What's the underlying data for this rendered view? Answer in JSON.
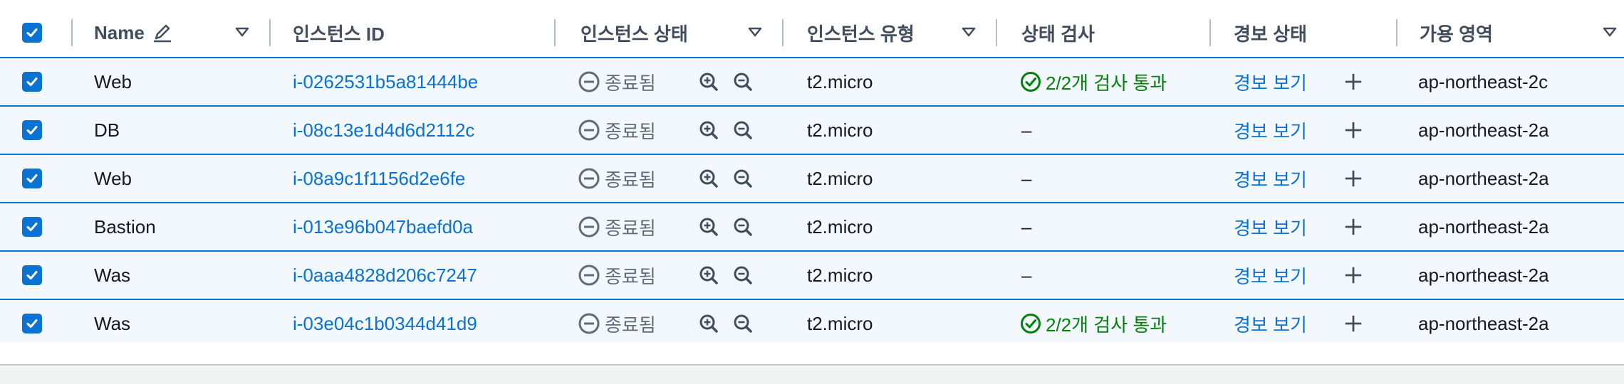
{
  "header": {
    "name": "Name",
    "instance_id": "인스턴스 ID",
    "instance_state": "인스턴스 상태",
    "instance_type": "인스턴스 유형",
    "status_check": "상태 검사",
    "alarm_status": "경보 상태",
    "availability_zone": "가용 영역"
  },
  "icons": {
    "checkbox": "checkbox-checked-icon",
    "edit": "pencil-icon",
    "sort": "caret-down-icon",
    "stopped": "minus-circle-icon",
    "zoom_in": "zoom-in-icon",
    "zoom_out": "zoom-out-icon",
    "pass": "check-circle-icon",
    "add": "plus-icon"
  },
  "colors": {
    "accent": "#0972d3",
    "row_selected_bg": "#f2f8fd",
    "pass_green": "#037f0c",
    "muted": "#5f6b7a"
  },
  "rows": [
    {
      "name": "Web",
      "id": "i-0262531b5a81444be",
      "state": "종료됨",
      "type": "t2.micro",
      "check": "2/2개 검사 통과",
      "alarm": "경보 보기",
      "az": "ap-northeast-2c"
    },
    {
      "name": "DB",
      "id": "i-08c13e1d4d6d2112c",
      "state": "종료됨",
      "type": "t2.micro",
      "check": "–",
      "alarm": "경보 보기",
      "az": "ap-northeast-2a"
    },
    {
      "name": "Web",
      "id": "i-08a9c1f1156d2e6fe",
      "state": "종료됨",
      "type": "t2.micro",
      "check": "–",
      "alarm": "경보 보기",
      "az": "ap-northeast-2a"
    },
    {
      "name": "Bastion",
      "id": "i-013e96b047baefd0a",
      "state": "종료됨",
      "type": "t2.micro",
      "check": "–",
      "alarm": "경보 보기",
      "az": "ap-northeast-2a"
    },
    {
      "name": "Was",
      "id": "i-0aaa4828d206c7247",
      "state": "종료됨",
      "type": "t2.micro",
      "check": "–",
      "alarm": "경보 보기",
      "az": "ap-northeast-2a"
    },
    {
      "name": "Was",
      "id": "i-03e04c1b0344d41d9",
      "state": "종료됨",
      "type": "t2.micro",
      "check": "2/2개 검사 통과",
      "alarm": "경보 보기",
      "az": "ap-northeast-2a"
    }
  ]
}
